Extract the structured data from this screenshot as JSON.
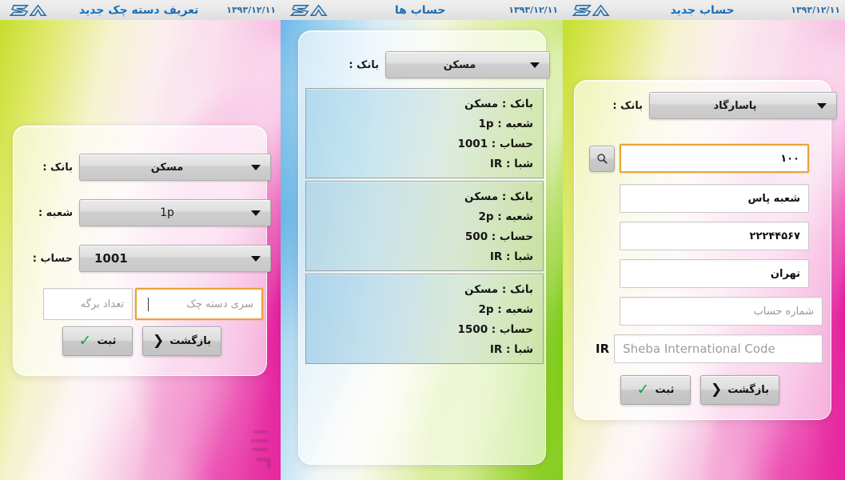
{
  "app": {
    "logo_alt": "sia-logo"
  },
  "screens": [
    {
      "id": "new-account",
      "header": {
        "title": "حساب جدید",
        "date": "۱۳۹۳/۱۲/۱۱",
        "logo": "sia-logo"
      },
      "form": {
        "bank_label": "بانک :",
        "bank_value": "پاسارگاد",
        "search_icon": "search-icon",
        "branch_code": {
          "value": "۱۰۰",
          "placeholder": ""
        },
        "branch_name": {
          "value": "شعبه پاس",
          "placeholder": ""
        },
        "phone": {
          "value": "۲۲۲۴۴۵۶۷",
          "placeholder": ""
        },
        "city": {
          "value": "تهران",
          "placeholder": ""
        },
        "account_number": {
          "value": "",
          "placeholder": "شماره حساب"
        },
        "sheba_prefix": "IR",
        "sheba": {
          "value": "",
          "placeholder": "Sheba International Code"
        },
        "submit_label": "ثبت",
        "back_label": "بازگشت"
      }
    },
    {
      "id": "accounts-list",
      "header": {
        "title": "حساب ها",
        "date": "۱۳۹۳/۱۲/۱۱",
        "logo": "sia-logo"
      },
      "filter": {
        "bank_label": "بانک :",
        "bank_value": "مسکن"
      },
      "list_labels": {
        "bank": "بانک :",
        "branch": "شعبه :",
        "account": "حساب :",
        "sheba": "شبا :"
      },
      "accounts": [
        {
          "bank": "مسکن",
          "branch": "1p",
          "account": "1001",
          "sheba": "IR"
        },
        {
          "bank": "مسکن",
          "branch": "2p",
          "account": "500",
          "sheba": "IR"
        },
        {
          "bank": "مسکن",
          "branch": "2p",
          "account": "1500",
          "sheba": "IR"
        }
      ]
    },
    {
      "id": "new-checkbook",
      "header": {
        "title": "تعریف دسته چک جدید",
        "date": "۱۳۹۳/۱۲/۱۱",
        "logo": "sia-logo"
      },
      "form": {
        "bank_label": "بانک :",
        "bank_value": "مسکن",
        "branch_label": "شعبه :",
        "branch_value": "1p",
        "account_label": "حساب :",
        "account_value": "1001",
        "series": {
          "value": "",
          "placeholder": "سری دسته چک"
        },
        "sheet_count": {
          "value": "",
          "placeholder": "تعداد برگه"
        },
        "submit_label": "ثبت",
        "back_label": "بازگشت"
      }
    }
  ],
  "colors": {
    "focus_border": "#e9a33a",
    "header_title": "#1b6fb5",
    "check_green": "#16a34a",
    "logo_blue": "#2a6ea6"
  }
}
